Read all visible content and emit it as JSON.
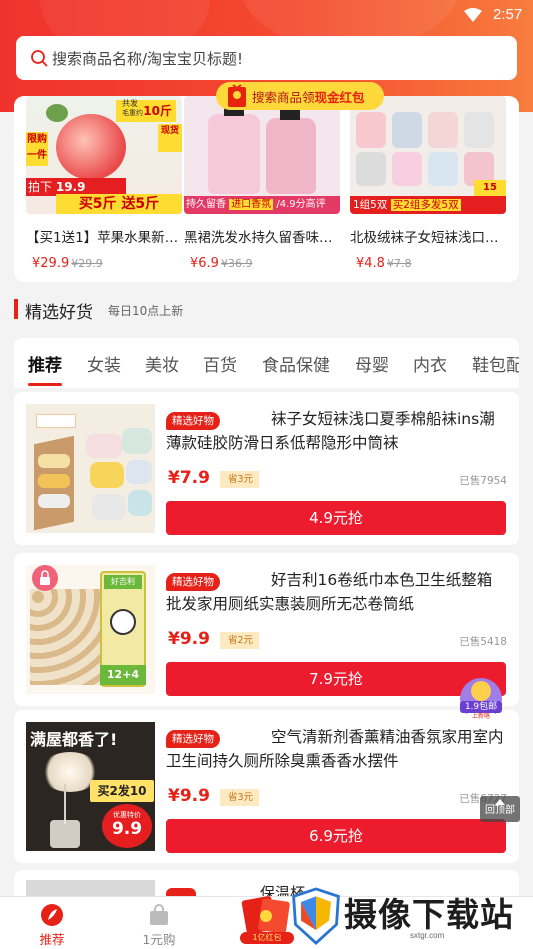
{
  "status_bar": {
    "time": "2:57"
  },
  "search": {
    "placeholder": "搜索商品名称/淘宝宝贝标题!"
  },
  "promo_banner": {
    "text_prefix": "搜索商品领",
    "text_highlight": "现金红包"
  },
  "top_products": [
    {
      "title": "【买1送1】苹果水果新…",
      "price": "¥29.9",
      "original_price": "¥29.9",
      "image_texts": [
        "共发",
        "毛重约",
        "10斤",
        "现货",
        "限购",
        "一件",
        "拍下",
        "19.9",
        "买5斤",
        "送5斤"
      ]
    },
    {
      "title": "黑裙洗发水持久留香味…",
      "price": "¥6.9",
      "original_price": "¥36.9",
      "image_texts": [
        "持久留香",
        "进口香氛",
        "/4.9分高评"
      ]
    },
    {
      "title": "北极绒袜子女短袜浅口…",
      "price": "¥4.8",
      "original_price": "¥7.8",
      "image_texts": [
        "1组5双",
        "买2组多发5双",
        "15"
      ]
    }
  ],
  "section": {
    "title": "精选好货",
    "subtitle": "每日10点上新"
  },
  "tabs": [
    "推荐",
    "女装",
    "美妆",
    "百货",
    "食品保健",
    "母婴",
    "内衣",
    "鞋包配"
  ],
  "items": [
    {
      "tag": "精选好物",
      "title": "袜子女短袜浅口夏季棉船袜ins潮薄款硅胶防滑日系低帮隐形中筒袜",
      "price": "¥7.9",
      "coupon": "省3元",
      "sold": "已售7954",
      "buy_label": "4.9元抢"
    },
    {
      "tag": "精选好物",
      "title": "好吉利16卷纸巾本色卫生纸整箱批发家用厕纸实惠装厕所无芯卷筒纸",
      "price": "¥9.9",
      "coupon": "省2元",
      "sold": "已售5418",
      "buy_label": "7.9元抢",
      "image_texts": [
        "好吉利",
        "12+4"
      ]
    },
    {
      "tag": "精选好物",
      "title": "空气清新剂香薰精油香氛家用室内卫生间持久厕所除臭熏香香水摆件",
      "price": "¥9.9",
      "coupon": "省3元",
      "sold": "已售6727",
      "buy_label": "6.9元抢",
      "image_texts": [
        "满屋都香了!",
        "买2发10",
        "优惠特价",
        "9.9"
      ]
    }
  ],
  "partial_item": {
    "text": "保温杯"
  },
  "float_badge": {
    "text": "1.9包邮",
    "sub": "上新咯"
  },
  "back_to_top": {
    "label": "回顶部"
  },
  "bottom_nav": [
    {
      "label": "推荐",
      "icon": "feather-icon",
      "active": true
    },
    {
      "label": "1元购",
      "icon": "bag-icon",
      "active": false
    },
    {
      "label": "1亿红包",
      "icon": "red-packet-icon",
      "active": false
    }
  ],
  "watermark": {
    "text": "摄像下载站",
    "sub": "sxtgr.com"
  },
  "colors": {
    "brand_red": "#e62117",
    "header_start": "#f0322e",
    "header_end": "#f87d3e",
    "coupon_bg": "#fdeac0"
  }
}
